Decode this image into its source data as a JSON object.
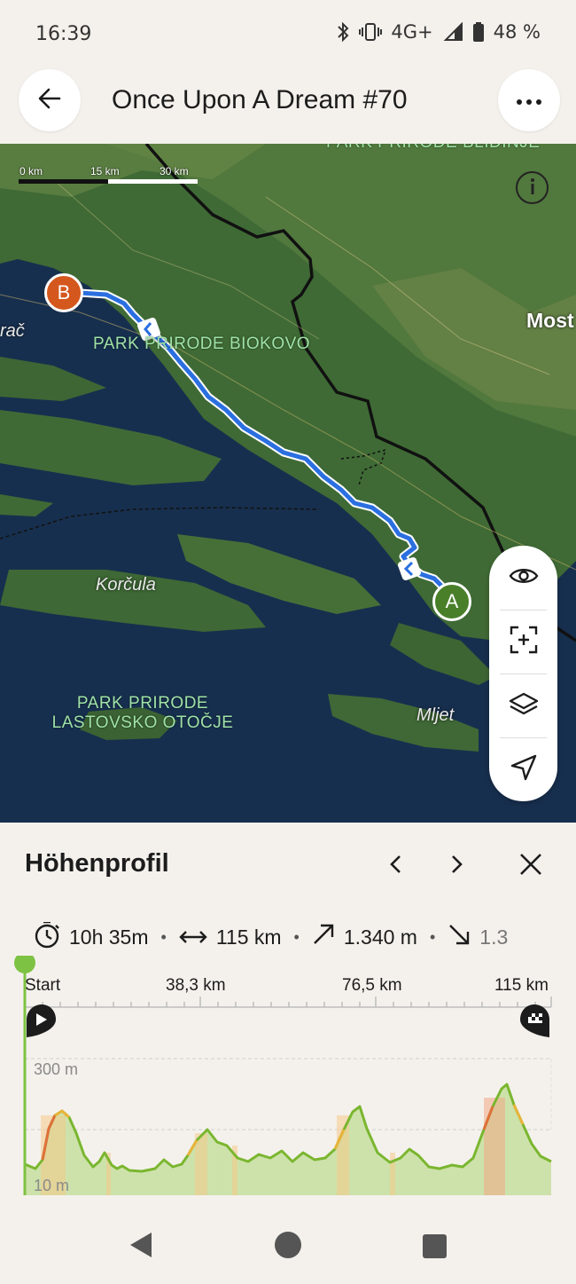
{
  "status_bar": {
    "time": "16:39",
    "network": "4G+",
    "roaming": "R",
    "battery": "48 %",
    "icons": [
      "bluetooth-icon",
      "vibrate-icon",
      "signal-icon",
      "battery-icon"
    ]
  },
  "header": {
    "title": "Once Upon A Dream #70",
    "back_icon": "arrow-left-icon",
    "more_icon": "more-horizontal-icon"
  },
  "map": {
    "scale": {
      "label_0": "0 km",
      "label_15": "15 km",
      "label_30": "30 km"
    },
    "labels": {
      "park_top": "PARK PRIRODE BLIDINJE",
      "park_biokovo": "PARK PRIRODE BIOKOVO",
      "city_mostar": "Most",
      "town_left": "rač",
      "island_korcula": "Korčula",
      "island_mljet": "Mljet",
      "park_lastovo_1": "PARK PRIRODE",
      "park_lastovo_2": "LASTOVSKO OTOČJE"
    },
    "markers": {
      "start": "A",
      "end": "B"
    },
    "colors": {
      "route": "#2b6fe0",
      "start_marker": "#4a7f2a",
      "end_marker": "#d4571e"
    },
    "tools": [
      "eye-icon",
      "fit-route-icon",
      "layers-icon",
      "navigate-icon"
    ]
  },
  "elevation": {
    "title": "Höhenprofil",
    "stats": {
      "duration": "10h 35m",
      "distance": "115 km",
      "ascent": "1.340 m",
      "descent": "1.3"
    },
    "x_labels": [
      "Start",
      "38,3 km",
      "76,5 km",
      "115 km"
    ],
    "y_labels": {
      "top": "300 m",
      "bottom": "10 m"
    },
    "colors": {
      "flat": "#7ab62f",
      "moderate": "#e8b43a",
      "steep": "#e0703a",
      "cursor": "#7dc242"
    }
  },
  "nav_bar": {
    "back": "back-triangle-icon",
    "home": "home-circle-icon",
    "recents": "recents-square-icon"
  }
}
